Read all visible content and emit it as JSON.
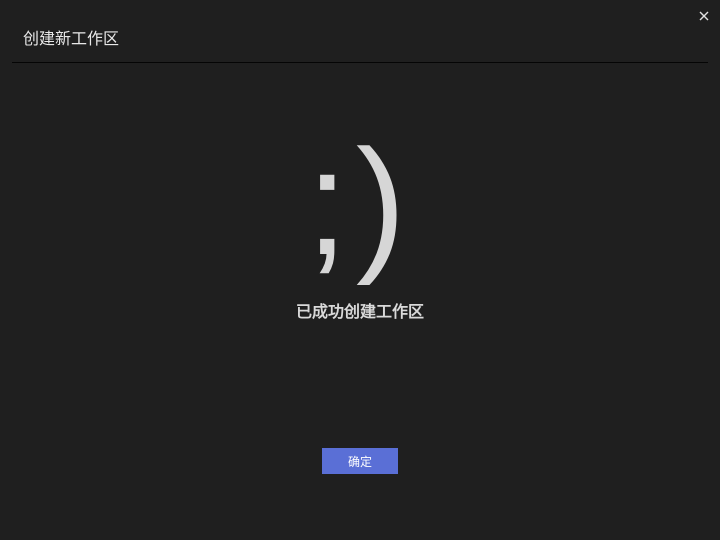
{
  "dialog": {
    "title": "创建新工作区",
    "close_icon": "close-icon",
    "emoticon": ";)",
    "message": "已成功创建工作区",
    "confirm_label": "确定"
  },
  "colors": {
    "background": "#1f1f1f",
    "accent": "#5a6fd6",
    "text": "#e6e6e6"
  }
}
